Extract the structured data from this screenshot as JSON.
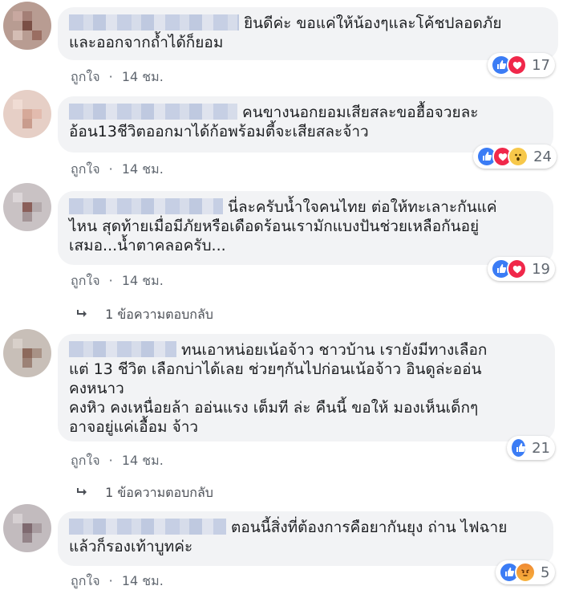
{
  "comments": [
    {
      "text": "ยินดีค่ะ ขอแค่ให้น้องๆและโค้ชปลอดภัย\nและออกจากถ้ำได้ก็ยอม",
      "like_label": "ถูกใจ",
      "time": "14 ชม.",
      "reactions": [
        "like",
        "love"
      ],
      "reaction_count": "17"
    },
    {
      "text": "คนขางนอกยอมเสียสละขอฮื้อจวยละ\nอ้อน13ชีวิตออกมาได้ก้อพร้อมตี้จะเสียสละจ้าว",
      "like_label": "ถูกใจ",
      "time": "14 ชม.",
      "reactions": [
        "like",
        "love",
        "wow"
      ],
      "reaction_count": "24"
    },
    {
      "text": "นี่ละครับน้ำใจคนไทย ต่อให้ทะเลาะกันแค่\nไหน สุดท้ายเมื่อมีภัยหรือเดือดร้อนเรามักแบงปันช่วยเหลือกันอยู่\nเสมอ...น้ำตาคลอครับ...",
      "like_label": "ถูกใจ",
      "time": "14 ชม.",
      "reactions": [
        "like",
        "love"
      ],
      "reaction_count": "19",
      "reply_label": "1 ข้อความตอบกลับ"
    },
    {
      "text": "ทนเอาหน่อยเน้อจ้าว ชาวบ้าน เรายังมีทางเลือก\nแต่ 13 ชีวิต เลือกบ่าได้เลย ช่วยๆกันไปก่อนเน้อจ้าว อินดูล่ะออ่น\nคงหนาว\nคงหิว คงเหนื่อยล้า ออ่นแรง เต็มที ล่ะ คืนนี้ ขอให้ มองเห็นเด็กๆ\nอาจอยู่แค่เอื้อม จ้าว",
      "like_label": "ถูกใจ",
      "time": "14 ชม.",
      "reactions": [
        "like"
      ],
      "reaction_count": "21",
      "reply_label": "1 ข้อความตอบกลับ"
    },
    {
      "text": "ตอนนี้สิ่งที่ต้องการคือยากันยุง ถ่าน ไฟฉาย\nแล้วก็รองเท้าบูทค่ะ",
      "like_label": "ถูกใจ",
      "time": "14 ชม.",
      "reactions": [
        "like",
        "angry"
      ],
      "reaction_count": "5"
    }
  ],
  "separator": "·",
  "colors": {
    "bubble": "#f2f3f5",
    "like": "#3b7cf5",
    "love": "#f0284a",
    "meta": "#606770"
  }
}
